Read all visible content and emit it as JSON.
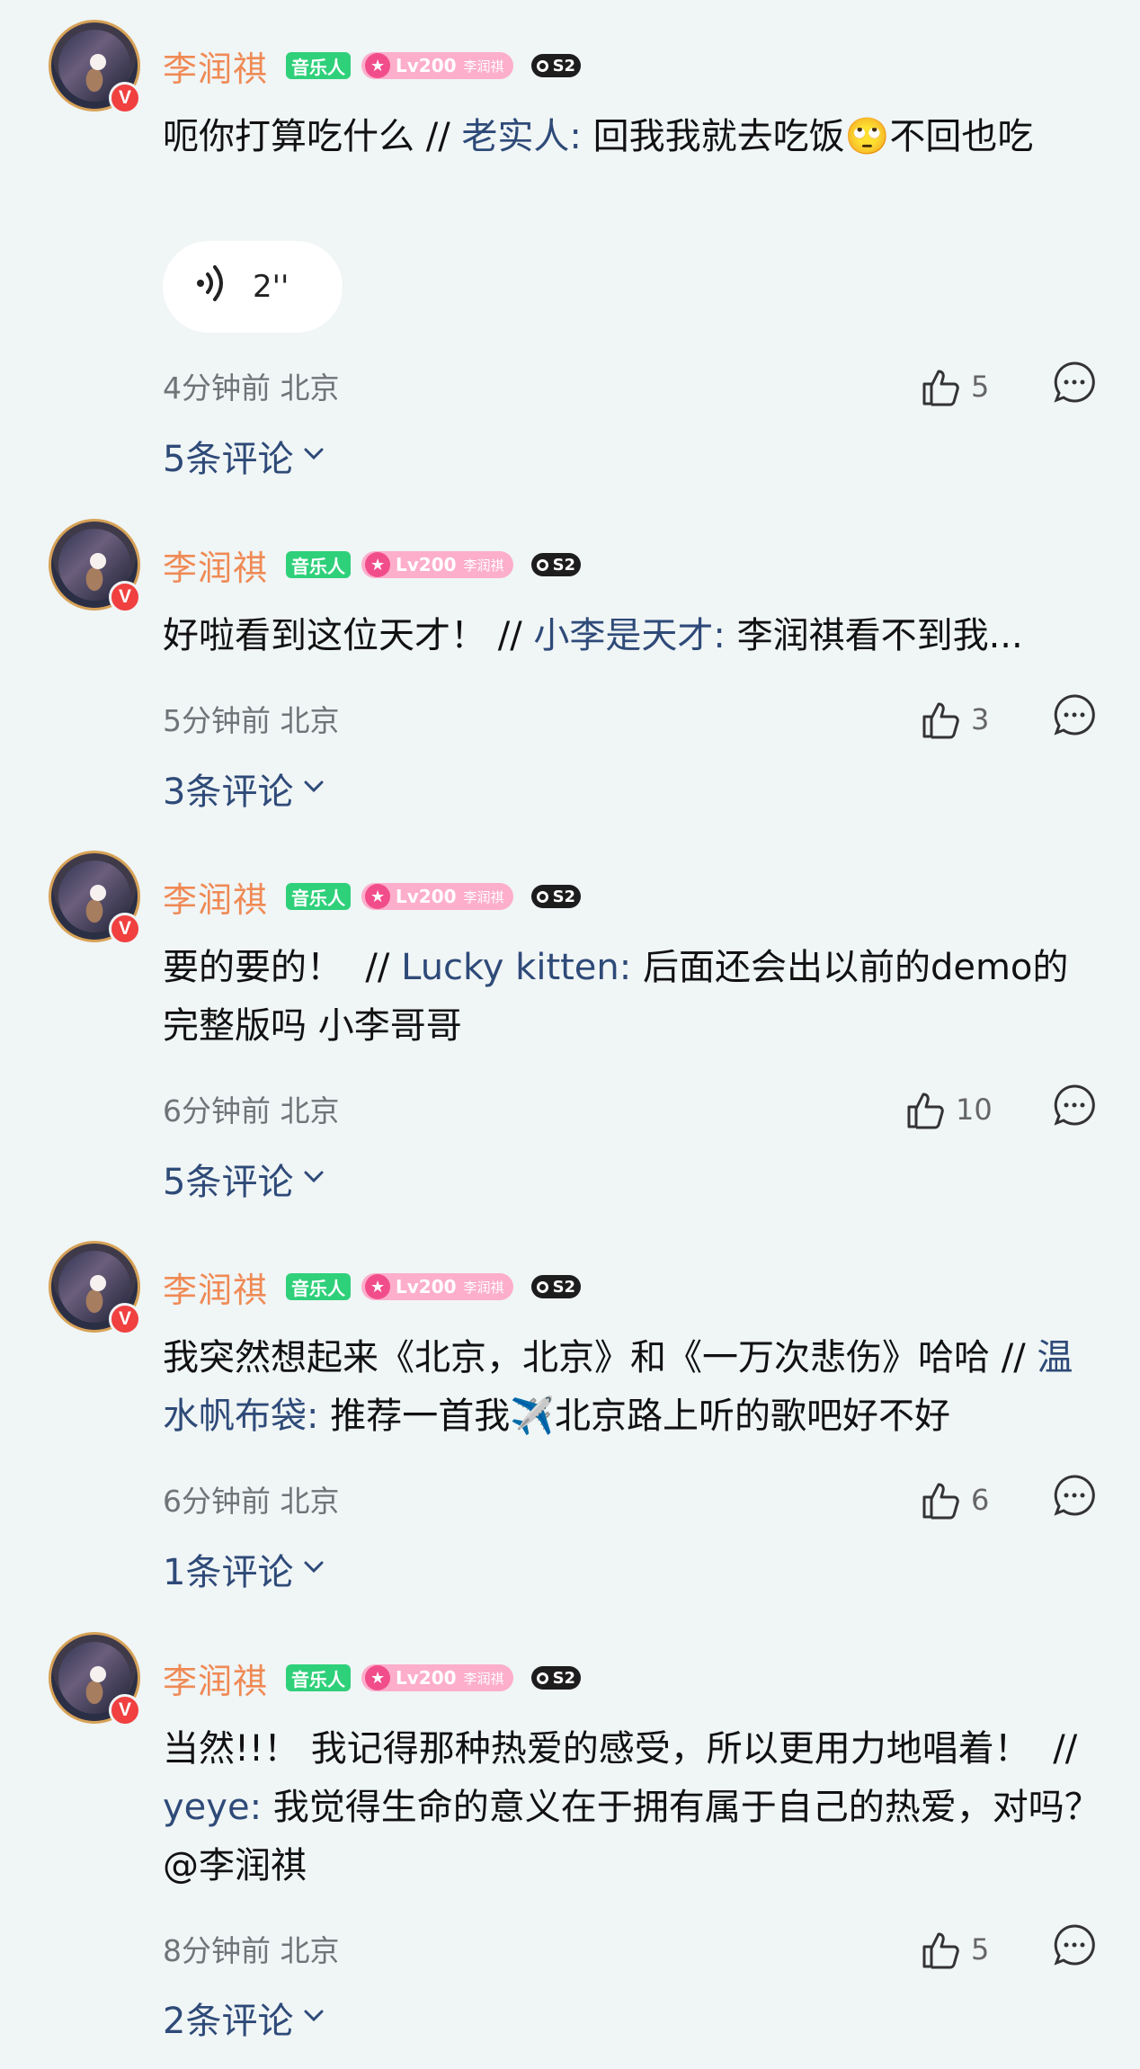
{
  "comments": [
    {
      "username": "李润祺",
      "badge_musician": "音乐人",
      "badge_level": "Lv200",
      "badge_level_name": "李润祺",
      "badge_s": "S2",
      "text_main": "呃你打算吃什么 // ",
      "reply_name": "老实人:",
      "text_reply": " 回我我就去吃饭🙄不回也吃",
      "voice_duration": "2''",
      "time_location": "4分钟前  北京",
      "likes": "5",
      "replies_label": "5条评论"
    },
    {
      "username": "李润祺",
      "badge_musician": "音乐人",
      "badge_level": "Lv200",
      "badge_level_name": "李润祺",
      "badge_s": "S2",
      "text_main": "好啦看到这位天才！  // ",
      "reply_name": "小李是天才:",
      "text_reply": " 李润祺看不到我...",
      "time_location": "5分钟前  北京",
      "likes": "3",
      "replies_label": "3条评论"
    },
    {
      "username": "李润祺",
      "badge_musician": "音乐人",
      "badge_level": "Lv200",
      "badge_level_name": "李润祺",
      "badge_s": "S2",
      "text_main": "要的要的！  // ",
      "reply_name": "Lucky kitten:",
      "text_reply": " 后面还会出以前的demo的完整版吗 小李哥哥",
      "time_location": "6分钟前  北京",
      "likes": "10",
      "replies_label": "5条评论"
    },
    {
      "username": "李润祺",
      "badge_musician": "音乐人",
      "badge_level": "Lv200",
      "badge_level_name": "李润祺",
      "badge_s": "S2",
      "text_main": "我突然想起来《北京，北京》和《一万次悲伤》哈哈 // ",
      "reply_name": "温水帆布袋:",
      "text_reply": " 推荐一首我✈️北京路上听的歌吧好不好",
      "time_location": "6分钟前  北京",
      "likes": "6",
      "replies_label": "1条评论"
    },
    {
      "username": "李润祺",
      "badge_musician": "音乐人",
      "badge_level": "Lv200",
      "badge_level_name": "李润祺",
      "badge_s": "S2",
      "text_main": "当然!!！ 我记得那种热爱的感受，所以更用力地唱着！  // ",
      "reply_name": "yeye:",
      "text_reply": " 我觉得生命的意义在于拥有属于自己的热爱，对吗？@李润祺",
      "time_location": "8分钟前  北京",
      "likes": "5",
      "replies_label": "2条评论"
    }
  ],
  "colors": {
    "background": "#f0f5f6",
    "username": "#ef8a55",
    "reply_name": "#2e4a78",
    "musician_badge": "#2fd07a",
    "level_badge": "#fcaecb",
    "verified_badge": "#f04040"
  },
  "icons": {
    "like": "thumbs-up-icon",
    "reply": "comment-bubble-icon",
    "verified": "verified-v-icon",
    "voice": "voice-wave-icon",
    "expand": "chevron-down-icon"
  }
}
